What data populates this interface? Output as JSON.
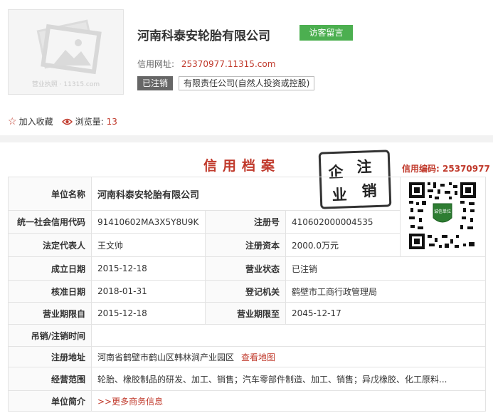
{
  "header": {
    "logo_watermark": "营业执照 · 11315.com",
    "company_name": "河南科泰安轮胎有限公司",
    "guest_button": "访客留言",
    "web_label": "信用网址:",
    "web_value": "25370977.11315.com",
    "status_badge": "已注销",
    "type_badge": "有限责任公司(自然人投资或控股)"
  },
  "actions": {
    "favorite_label": "加入收藏",
    "views_label": "浏览量:",
    "views_count": "13"
  },
  "archive": {
    "title": "信用档案",
    "stamp_chars": [
      "注",
      "企",
      "销",
      "业"
    ],
    "credit_code_label": "信用编码:",
    "credit_code_value": "25370977"
  },
  "table": {
    "unit_name_label": "单位名称",
    "unit_name_value": "河南科泰安轮胎有限公司",
    "uscc_label": "统一社会信用代码",
    "uscc_value": "91410602MA3X5Y8U9K",
    "reg_no_label": "注册号",
    "reg_no_value": "410602000004535",
    "legal_rep_label": "法定代表人",
    "legal_rep_value": "王文帅",
    "capital_label": "注册资本",
    "capital_value": "2000.0万元",
    "founded_label": "成立日期",
    "founded_value": "2015-12-18",
    "biz_status_label": "营业状态",
    "biz_status_value": "已注销",
    "approved_label": "核准日期",
    "approved_value": "2018-01-31",
    "authority_label": "登记机关",
    "authority_value": "鹤壁市工商行政管理局",
    "term_start_label": "营业期限自",
    "term_start_value": "2015-12-18",
    "term_end_label": "营业期限至",
    "term_end_value": "2045-12-17",
    "revoke_label": "吊销/注销时间",
    "revoke_value": "",
    "address_label": "注册地址",
    "address_value": "河南省鹤壁市鹤山区韩林涧产业园区",
    "map_link": "查看地图",
    "scope_label": "经营范围",
    "scope_value": "轮胎、橡胶制品的研发、加工、销售；汽车零部件制造、加工、销售；异戊橡胶、化工原料...",
    "intro_label": "单位简介",
    "intro_link": ">>更多商务信息"
  },
  "qr": {
    "badge_text": "诚信单位"
  },
  "colors": {
    "accent_red": "#c0392b",
    "green_button": "#4caf50",
    "status_grey": "#666666"
  }
}
